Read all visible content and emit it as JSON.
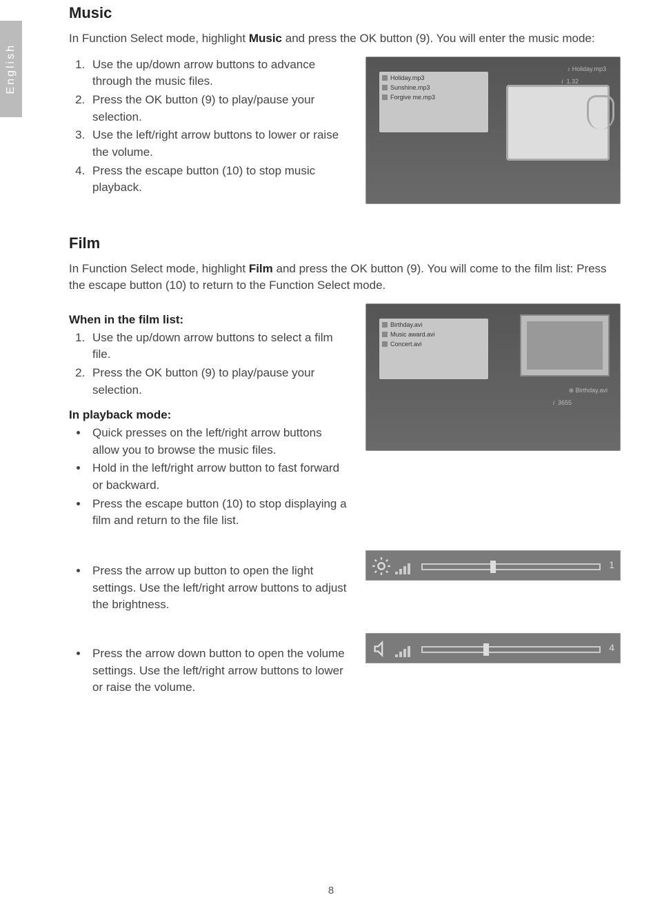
{
  "language_tab": "English",
  "page_number": "8",
  "music": {
    "heading": "Music",
    "intro_pre": "In Function Select mode, highlight ",
    "intro_bold": "Music",
    "intro_post": " and press the OK button (9). You will enter the music mode:",
    "steps": [
      "Use the up/down arrow buttons to advance through the music files.",
      "Press the OK button (9) to play/pause your selection.",
      "Use the left/right arrow buttons to lower or raise the volume.",
      "Press the escape button (10) to stop music playback."
    ],
    "shot": {
      "items": [
        "Holiday.mp3",
        "Sunshine.mp3",
        "Forgive me.mp3"
      ],
      "meta_title": "Holiday.mp3",
      "meta_info": "1.32"
    }
  },
  "film": {
    "heading": "Film",
    "intro_pre": "In Function Select mode, highlight ",
    "intro_bold": "Film",
    "intro_post": " and press the OK button (9). You will come to the film list: Press the escape button (10) to return to the Function Select mode.",
    "list_heading": "When in the film list:",
    "list_steps": [
      "Use the up/down arrow buttons to select a film file.",
      "Press the OK button (9) to play/pause your selection."
    ],
    "playback_heading": "In playback mode:",
    "playback_bullets": [
      "Quick presses on the left/right arrow buttons allow you to browse the music files.",
      "Hold in the left/right arrow button to fast forward or backward.",
      "Press the escape button (10) to stop displaying a film and return to the file list."
    ],
    "brightness_bullet": "Press the arrow up button to open the light settings. Use the left/right arrow buttons to adjust the brightness.",
    "volume_bullet": "Press the arrow down button to open the volume settings. Use the left/right arrow buttons to lower or raise the volume.",
    "shot": {
      "items": [
        "Birthday.avi",
        "Music award.avi",
        "Concert.avi"
      ],
      "meta_title": "Birthday.avi",
      "meta_info": "3655"
    },
    "brightness_value": "1",
    "volume_value": "4"
  }
}
